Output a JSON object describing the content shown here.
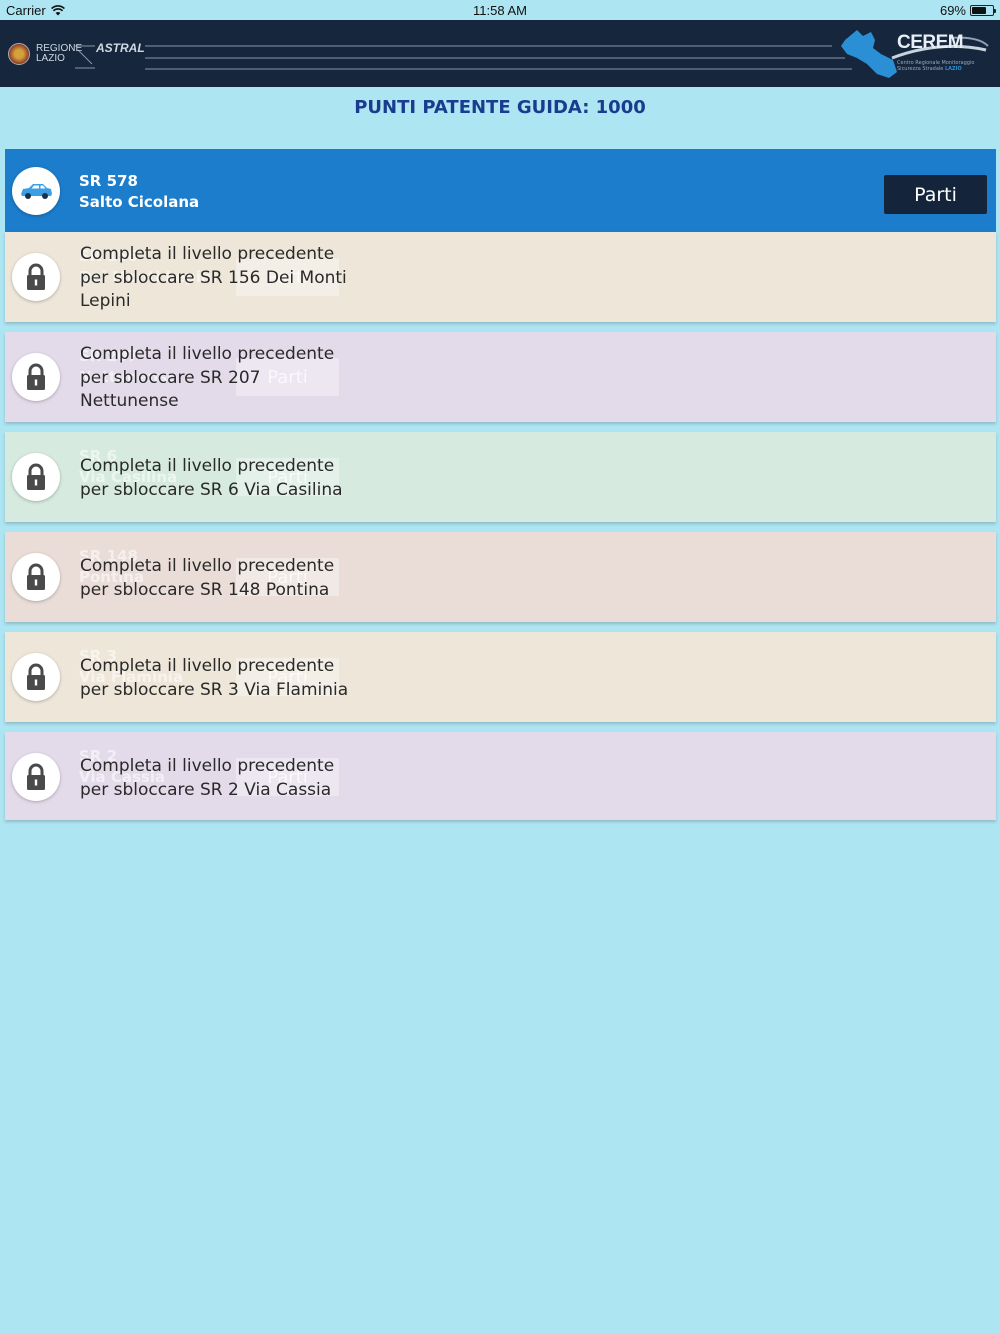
{
  "status_bar": {
    "carrier": "Carrier",
    "time": "11:58 AM",
    "battery": "69%"
  },
  "header": {
    "left_logo_regione": "REGIONE LAZIO",
    "left_logo_astral": "ASTRAL",
    "right_logo": "CEREM",
    "right_logo_sub_1": "Centro Regionale Monitoraggio",
    "right_logo_sub_2": "Sicurezza Stradale",
    "right_logo_sub_region": "LAZIO"
  },
  "title": "PUNTI PATENTE GUIDA: 1000",
  "active_level": {
    "road": "SR 578",
    "name": "Salto Cicolana",
    "button": "Parti"
  },
  "locked_levels": [
    {
      "road": "SR 156",
      "name": "Dei Monti Lepini",
      "lines": [
        "Completa il livello precedente",
        "per sbloccare SR 156 Dei Monti",
        "Lepini"
      ],
      "button": "Parti",
      "bg": "#ede6d9"
    },
    {
      "road": "SR 207",
      "name": "Nettunense",
      "lines": [
        "Completa il livello precedente",
        "per sbloccare SR 207",
        "Nettunense"
      ],
      "button": "Parti",
      "bg": "#e3dbea"
    },
    {
      "road": "SR 6",
      "name": "Via Casilina",
      "lines": [
        "Completa il livello precedente",
        "per sbloccare SR 6 Via Casilina"
      ],
      "button": "Parti",
      "bg": "#d6eadf"
    },
    {
      "road": "SR 148",
      "name": "Pontina",
      "lines": [
        "Completa il livello precedente",
        "per sbloccare SR 148 Pontina"
      ],
      "button": "Parti",
      "bg": "#eaddd8"
    },
    {
      "road": "SR 3",
      "name": "Via Flaminia",
      "lines": [
        "Completa il livello precedente",
        "per sbloccare SR 3 Via Flaminia"
      ],
      "button": "Parti",
      "bg": "#ede6d9"
    },
    {
      "road": "SR 2",
      "name": "Via Cassia",
      "lines": [
        "Completa il livello precedente",
        "per sbloccare SR 2 Via Cassia"
      ],
      "button": "Parti",
      "bg": "#e3dbea"
    }
  ],
  "colors": {
    "background": "#ade5f2",
    "header": "#15263d",
    "active": "#1b7dcb",
    "title": "#1a3c8f"
  },
  "icons": {
    "active": "car-icon",
    "locked": "lock-icon"
  }
}
